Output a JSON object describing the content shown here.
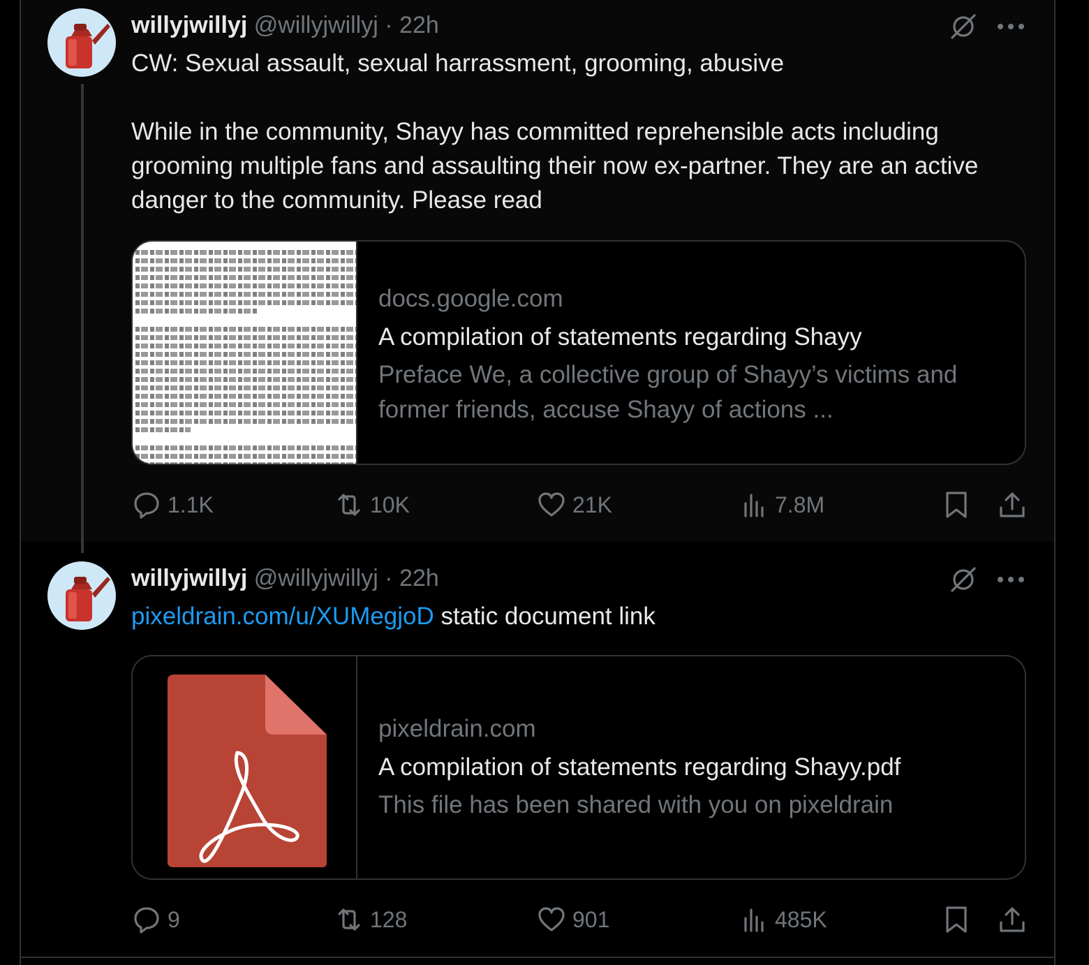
{
  "tweets": [
    {
      "display_name": "willyjwillyj",
      "handle": "@willyjwillyj",
      "separator": "·",
      "time": "22h",
      "text": "CW: Sexual assault, sexual harrassment, grooming, abusive\n\nWhile in the community, Shayy has committed reprehensible acts including grooming multiple fans and assaulting their now ex-partner. They are an active danger to the community. Please read",
      "card": {
        "domain": "docs.google.com",
        "title": "A compilation of statements regarding Shayy",
        "description": "Preface We, a collective group of Shayy’s victims and former friends, accuse Shayy of actions ...",
        "thumbnail_icon": "document-preview-icon"
      },
      "stats": {
        "replies": "1.1K",
        "reposts": "10K",
        "likes": "21K",
        "views": "7.8M"
      }
    },
    {
      "display_name": "willyjwillyj",
      "handle": "@willyjwillyj",
      "separator": "·",
      "time": "22h",
      "link_text": "pixeldrain.com/u/XUMegjoD",
      "text_after_link": " static document link",
      "card": {
        "domain": "pixeldrain.com",
        "title": "A compilation of statements regarding Shayy.pdf",
        "description": "This file has been shared with you on pixeldrain",
        "thumbnail_icon": "pdf-file-icon"
      },
      "stats": {
        "replies": "9",
        "reposts": "128",
        "likes": "901",
        "views": "485K"
      }
    }
  ],
  "colors": {
    "background": "#000000",
    "text_primary": "#e7e9ea",
    "text_secondary": "#71767b",
    "link": "#1d9bf0",
    "border": "#2f3336",
    "avatar_bg": "#cfe8f7",
    "pdf_red": "#b84436"
  },
  "icons": [
    "grok-icon",
    "more-icon",
    "reply-icon",
    "repost-icon",
    "like-icon",
    "views-icon",
    "bookmark-icon",
    "share-icon",
    "gas-can-avatar-icon"
  ]
}
